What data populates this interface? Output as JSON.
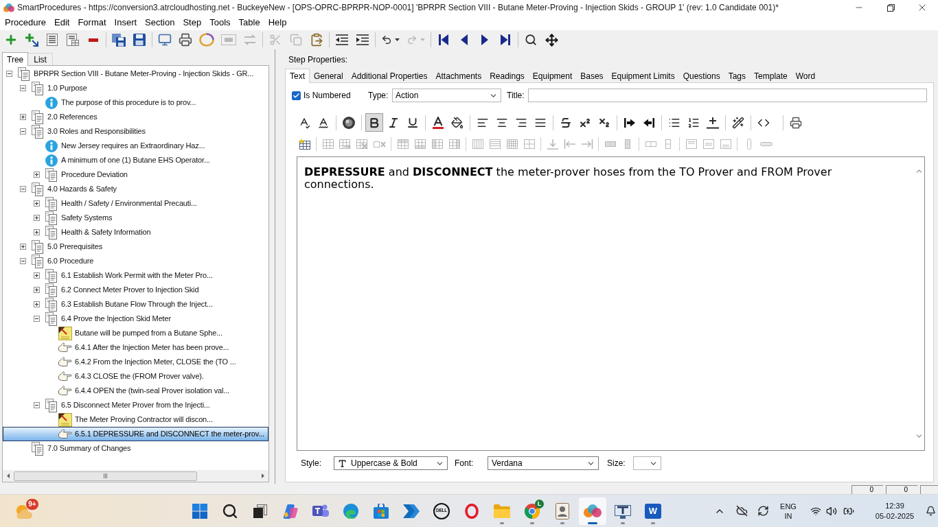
{
  "window": {
    "title": "SmartProcedures - https://conversion3.atrcloudhosting.net - BuckeyeNew - [OPS-OPRC-BPRPR-NOP-0001] 'BPRPR Section VIII - Butane Meter-Proving - Injection Skids - GROUP 1' (rev: 1.0 Candidate 001)*"
  },
  "menu": [
    "Procedure",
    "Edit",
    "Format",
    "Insert",
    "Section",
    "Step",
    "Tools",
    "Table",
    "Help"
  ],
  "toolbar": [
    [
      {
        "kind": "add",
        "disabled": false
      },
      {
        "kind": "add-child",
        "disabled": false
      },
      {
        "kind": "properties",
        "disabled": false
      },
      {
        "kind": "details",
        "disabled": false
      },
      {
        "kind": "delete",
        "disabled": false
      }
    ],
    [
      {
        "kind": "save-all",
        "disabled": false
      },
      {
        "kind": "save",
        "disabled": false
      }
    ],
    [
      {
        "kind": "computer",
        "disabled": false
      },
      {
        "kind": "print",
        "disabled": false
      },
      {
        "kind": "ring",
        "disabled": false
      },
      {
        "kind": "frame",
        "disabled": true
      },
      {
        "kind": "swap",
        "disabled": true
      }
    ],
    [
      {
        "kind": "cut",
        "disabled": true
      },
      {
        "kind": "copy",
        "disabled": true
      },
      {
        "kind": "paste",
        "disabled": false
      }
    ],
    [
      {
        "kind": "outdent",
        "disabled": false
      },
      {
        "kind": "indent",
        "disabled": false
      }
    ],
    [
      {
        "kind": "undo",
        "disabled": false
      },
      {
        "kind": "redo",
        "disabled": true
      }
    ],
    [
      {
        "kind": "first",
        "disabled": false
      },
      {
        "kind": "previous",
        "disabled": false
      },
      {
        "kind": "next",
        "disabled": false
      },
      {
        "kind": "last",
        "disabled": false
      }
    ],
    [
      {
        "kind": "find",
        "disabled": false
      },
      {
        "kind": "move",
        "disabled": false
      }
    ]
  ],
  "left_tabs": [
    {
      "label": "Tree",
      "selected": true
    },
    {
      "label": "List",
      "selected": false
    }
  ],
  "tree": {
    "label": "BPRPR Section VIII - Butane Meter-Proving - Injection Skids - GR...",
    "kind": "section",
    "expanded": true,
    "selected": false,
    "children": [
      {
        "label": "1.0 Purpose",
        "kind": "section",
        "expanded": true,
        "selected": false,
        "children": [
          {
            "label": "The purpose of this procedure is to prov...",
            "kind": "info",
            "selected": false
          }
        ]
      },
      {
        "label": "2.0 References",
        "kind": "section",
        "expanded": false,
        "selected": false
      },
      {
        "label": "3.0 Roles and Responsibilities",
        "kind": "section",
        "expanded": true,
        "selected": false,
        "children": [
          {
            "label": "New Jersey requires an Extraordinary Haz...",
            "kind": "info",
            "selected": false
          },
          {
            "label": "A minimum of one (1) Butane EHS Operator...",
            "kind": "info",
            "selected": false
          },
          {
            "label": "Procedure Deviation",
            "kind": "section",
            "expanded": false,
            "selected": false
          }
        ]
      },
      {
        "label": "4.0 Hazards & Safety",
        "kind": "section",
        "expanded": true,
        "selected": false,
        "children": [
          {
            "label": "Health / Safety / Environmental Precauti...",
            "kind": "section",
            "expanded": false,
            "selected": false
          },
          {
            "label": "Safety Systems",
            "kind": "section",
            "expanded": false,
            "selected": false
          },
          {
            "label": "Health & Safety Information",
            "kind": "section",
            "expanded": false,
            "selected": false
          }
        ]
      },
      {
        "label": "5.0 Prerequisites",
        "kind": "section",
        "expanded": false,
        "selected": false
      },
      {
        "label": "6.0 Procedure",
        "kind": "section",
        "expanded": true,
        "selected": false,
        "children": [
          {
            "label": "6.1 Establish Work Permit with the Meter Pro...",
            "kind": "section",
            "expanded": false,
            "selected": false
          },
          {
            "label": "6.2 Connect Meter Prover to Injection Skid",
            "kind": "section",
            "expanded": false,
            "selected": false
          },
          {
            "label": "6.3 Establish Butane Flow Through the Inject...",
            "kind": "section",
            "expanded": false,
            "selected": false
          },
          {
            "label": "6.4 Prove the Injection Skid Meter",
            "kind": "section",
            "expanded": true,
            "selected": false,
            "children": [
              {
                "label": "Butane will be pumped from a Butane Sphe...",
                "kind": "note",
                "selected": false
              },
              {
                "label": "6.4.1 After the Injection Meter has been prove...",
                "kind": "step",
                "selected": false
              },
              {
                "label": "6.4.2 From the Injection Meter, CLOSE the (TO ...",
                "kind": "step",
                "selected": false
              },
              {
                "label": "6.4.3 CLOSE the (FROM Prover valve).",
                "kind": "step",
                "selected": false
              },
              {
                "label": "6.4.4 OPEN the (twin-seal Prover isolation val...",
                "kind": "step",
                "selected": false
              }
            ]
          },
          {
            "label": "6.5 Disconnect Meter Prover from the Injecti...",
            "kind": "section",
            "expanded": true,
            "selected": false,
            "children": [
              {
                "label": "The Meter Proving Contractor will discon...",
                "kind": "note",
                "selected": false
              },
              {
                "label": "6.5.1 DEPRESSURE and DISCONNECT the meter-prov...",
                "kind": "step",
                "selected": true
              }
            ]
          }
        ]
      },
      {
        "label": "7.0 Summary of Changes",
        "kind": "section",
        "selected": false
      }
    ]
  },
  "step_properties": {
    "label": "Step Properties:",
    "tabs": [
      {
        "label": "Text",
        "selected": true
      },
      {
        "label": "General",
        "selected": false
      },
      {
        "label": "Additional Properties",
        "selected": false
      },
      {
        "label": "Attachments",
        "selected": false
      },
      {
        "label": "Readings",
        "selected": false
      },
      {
        "label": "Equipment",
        "selected": false
      },
      {
        "label": "Bases",
        "selected": false
      },
      {
        "label": "Equipment Limits",
        "selected": false
      },
      {
        "label": "Questions",
        "selected": false
      },
      {
        "label": "Tags",
        "selected": false
      },
      {
        "label": "Template",
        "selected": false
      },
      {
        "label": "Word",
        "selected": false
      }
    ],
    "is_numbered": {
      "label": "Is Numbered",
      "checked": true
    },
    "type": {
      "label": "Type:",
      "value": "Action"
    },
    "title": {
      "label": "Title:"
    },
    "format_bar": [
      [
        {
          "kind": "spellcheck"
        },
        {
          "kind": "spellcheck-auto"
        }
      ],
      [
        {
          "kind": "sphere"
        }
      ],
      [
        {
          "kind": "bold",
          "active": true
        },
        {
          "kind": "italic",
          "active": false
        },
        {
          "kind": "underline",
          "active": false
        }
      ],
      [
        {
          "kind": "font-color"
        },
        {
          "kind": "fill-color"
        }
      ],
      [
        {
          "kind": "align-left",
          "active": false
        },
        {
          "kind": "align-center",
          "active": false
        },
        {
          "kind": "align-right",
          "active": false
        },
        {
          "kind": "justify",
          "active": false
        }
      ],
      [
        {
          "kind": "strikethrough",
          "active": false
        },
        {
          "kind": "superscript",
          "active": false
        },
        {
          "kind": "subscript",
          "active": false
        }
      ],
      [
        {
          "kind": "bar-arrow"
        },
        {
          "kind": "arrow-bar"
        }
      ],
      [
        {
          "kind": "bullets"
        },
        {
          "kind": "numbering"
        },
        {
          "kind": "rule"
        }
      ],
      [
        {
          "kind": "wand"
        }
      ],
      [
        {
          "kind": "code"
        }
      ],
      [
        {
          "kind": "print"
        }
      ]
    ],
    "table_bar": [
      [
        {
          "kind": "insert-table",
          "disabled": false
        }
      ],
      [
        {
          "kind": "table",
          "disabled": true
        },
        {
          "kind": "table-move",
          "disabled": true
        },
        {
          "kind": "table-x",
          "disabled": true
        },
        {
          "kind": "cell-x",
          "disabled": true
        }
      ],
      [
        {
          "kind": "row-top",
          "disabled": true
        },
        {
          "kind": "row-bottom",
          "disabled": true
        },
        {
          "kind": "column-left",
          "disabled": true
        },
        {
          "kind": "column-right",
          "disabled": true
        }
      ],
      [
        {
          "kind": "columns",
          "disabled": true
        },
        {
          "kind": "rows",
          "disabled": true
        },
        {
          "kind": "grid-dense",
          "disabled": true
        },
        {
          "kind": "grid-wide",
          "disabled": true
        }
      ],
      [
        {
          "kind": "arrow-down",
          "disabled": true
        },
        {
          "kind": "arrow-left",
          "disabled": true
        },
        {
          "kind": "arrow-right",
          "disabled": true
        }
      ],
      [
        {
          "kind": "merge-horizontal",
          "disabled": true
        },
        {
          "kind": "merge-vertical",
          "disabled": true
        }
      ],
      [
        {
          "kind": "split-horizontal",
          "disabled": true
        },
        {
          "kind": "split-vertical",
          "disabled": true
        }
      ],
      [
        {
          "kind": "align-top",
          "disabled": true
        },
        {
          "kind": "align-middle",
          "disabled": true
        },
        {
          "kind": "align-bottom",
          "disabled": true
        }
      ],
      [
        {
          "kind": "tall-bar",
          "disabled": true
        },
        {
          "kind": "wide-bar",
          "disabled": true
        }
      ]
    ],
    "editor": {
      "text": "**DEPRESSURE** and **DISCONNECT** the meter-prover hoses from the TO Prover and FROM Prover connections."
    },
    "style": {
      "label": "Style:",
      "value": "Uppercase & Bold"
    },
    "font": {
      "label": "Font:",
      "value": "Verdana"
    },
    "size": {
      "label": "Size:"
    }
  },
  "status_bar": [
    "0",
    "0"
  ],
  "taskbar": {
    "weather": {
      "badge": "9+"
    },
    "apps": [
      {
        "kind": "start",
        "running": false,
        "active": false
      },
      {
        "kind": "search",
        "running": false,
        "active": false
      },
      {
        "kind": "taskview",
        "running": false,
        "active": false
      },
      {
        "kind": "copilot",
        "running": false,
        "active": false
      },
      {
        "kind": "teams",
        "running": false,
        "active": false
      },
      {
        "kind": "edge",
        "running": false,
        "active": false
      },
      {
        "kind": "store",
        "running": false,
        "active": false
      },
      {
        "kind": "automate",
        "running": false,
        "active": false
      },
      {
        "kind": "dell",
        "label": "DELL",
        "running": false,
        "active": false
      },
      {
        "kind": "opera",
        "running": false,
        "active": false
      },
      {
        "kind": "explorer",
        "running": true,
        "active": false
      },
      {
        "kind": "chrome",
        "badge": "L",
        "running": true,
        "active": false
      },
      {
        "kind": "idcard",
        "running": true,
        "active": false
      },
      {
        "kind": "smartprocedures",
        "running": true,
        "active": true
      },
      {
        "kind": "remote",
        "running": true,
        "active": false
      },
      {
        "kind": "word",
        "label": "W",
        "running": true,
        "active": false
      }
    ],
    "tray": {
      "language": "ENG",
      "region": "IN",
      "time": "12:39",
      "date": "05-02-2025"
    }
  }
}
